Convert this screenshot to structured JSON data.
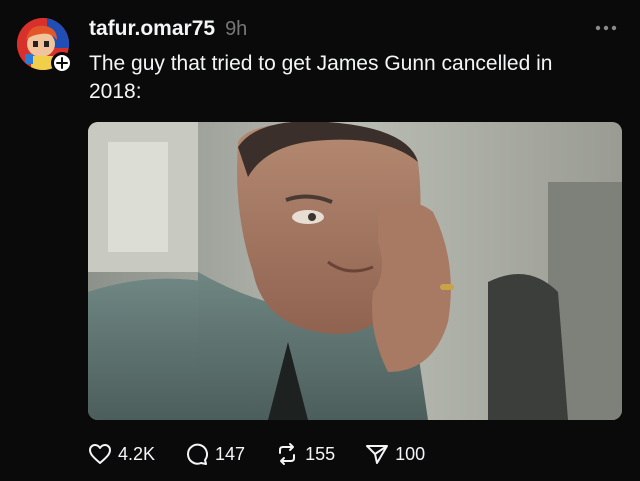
{
  "post": {
    "username": "tafur.omar75",
    "timestamp": "9h",
    "caption": "The guy that tried to get James Gunn cancelled in 2018:",
    "actions": {
      "likes": "4.2K",
      "replies": "147",
      "reposts": "155",
      "shares": "100"
    }
  },
  "icons": {
    "like": "heart-icon",
    "reply": "speech-bubble-icon",
    "repost": "repost-arrows-icon",
    "share": "paper-plane-icon",
    "more": "ellipsis-icon",
    "follow": "plus-icon"
  },
  "colors": {
    "background": "#0a0a0a",
    "text": "#f3f5f7",
    "muted": "#777777"
  }
}
